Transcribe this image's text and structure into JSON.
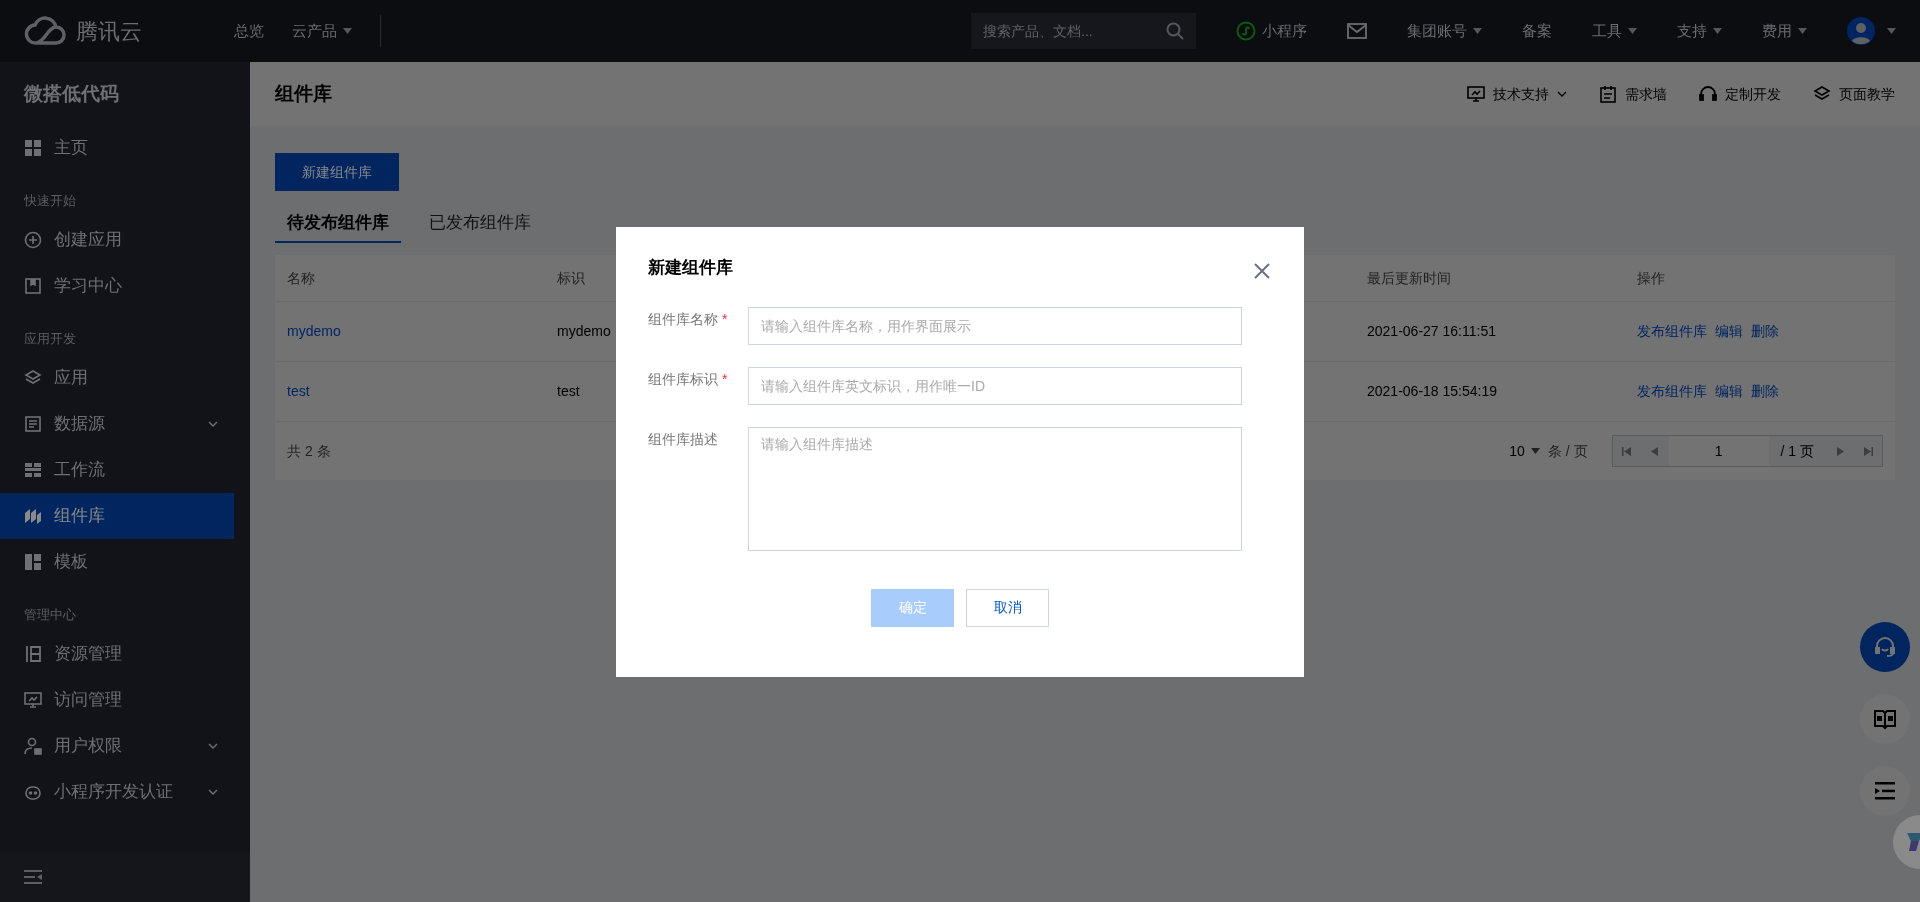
{
  "topbar": {
    "brand": "腾讯云",
    "nav": [
      {
        "label": "总览",
        "dropdown": false
      },
      {
        "label": "云产品",
        "dropdown": true
      }
    ],
    "search": {
      "placeholder": "搜索产品、文档..."
    },
    "links": [
      {
        "kind": "miniprogram",
        "label": "小程序",
        "dropdown": false
      },
      {
        "kind": "mail",
        "dropdown": false
      },
      {
        "kind": "text",
        "label": "集团账号",
        "dropdown": true
      },
      {
        "kind": "text",
        "label": "备案",
        "dropdown": false
      },
      {
        "kind": "text",
        "label": "工具",
        "dropdown": true
      },
      {
        "kind": "text",
        "label": "支持",
        "dropdown": true
      },
      {
        "kind": "text",
        "label": "费用",
        "dropdown": true
      },
      {
        "kind": "avatar",
        "dropdown": true
      }
    ]
  },
  "sidebar": {
    "title": "微搭低代码",
    "groups": [
      {
        "items": [
          {
            "label": "主页",
            "expandable": false,
            "selected": false
          }
        ]
      },
      {
        "heading": "快速开始",
        "items": [
          {
            "label": "创建应用",
            "expandable": false,
            "selected": false
          },
          {
            "label": "学习中心",
            "expandable": false,
            "selected": false
          }
        ]
      },
      {
        "heading": "应用开发",
        "items": [
          {
            "label": "应用",
            "expandable": false,
            "selected": false
          },
          {
            "label": "数据源",
            "expandable": true,
            "selected": false
          },
          {
            "label": "工作流",
            "expandable": false,
            "selected": false
          },
          {
            "label": "组件库",
            "expandable": false,
            "selected": true
          },
          {
            "label": "模板",
            "expandable": false,
            "selected": false
          }
        ]
      },
      {
        "heading": "管理中心",
        "items": [
          {
            "label": "资源管理",
            "expandable": false,
            "selected": false
          },
          {
            "label": "访问管理",
            "expandable": false,
            "selected": false
          },
          {
            "label": "用户权限",
            "expandable": true,
            "selected": false
          },
          {
            "label": "小程序开发认证",
            "expandable": true,
            "selected": false
          }
        ]
      }
    ]
  },
  "header": {
    "title": "组件库",
    "actions": [
      {
        "label": "技术支持",
        "dropdown": true
      },
      {
        "label": "需求墙",
        "dropdown": false
      },
      {
        "label": "定制开发",
        "dropdown": false
      },
      {
        "label": "页面教学",
        "dropdown": false
      }
    ]
  },
  "new_button": "新建组件库",
  "tabs": [
    {
      "label": "待发布组件库",
      "selected": true
    },
    {
      "label": "已发布组件库",
      "selected": false
    }
  ],
  "table": {
    "columns": [
      "名称",
      "标识",
      "最后更新时间",
      "操作"
    ],
    "rows": [
      {
        "name": "mydemo",
        "id": "mydemo",
        "updated": "2021-06-27 16:11:51",
        "actions": [
          "发布组件库",
          "编辑",
          "删除"
        ]
      },
      {
        "name": "test",
        "id": "test",
        "updated": "2021-06-18 15:54:19",
        "actions": [
          "发布组件库",
          "编辑",
          "删除"
        ]
      }
    ],
    "total": "共 2 条",
    "page_size": "10",
    "page_size_unit": "条 / 页",
    "page": "1",
    "pages": "/ 1 页"
  },
  "dialog": {
    "title": "新建组件库",
    "fields": [
      {
        "kind": "input",
        "label": "组件库名称",
        "required_mark": "*",
        "placeholder": "请输入组件库名称，用作界面展示"
      },
      {
        "kind": "input",
        "label": "组件库标识",
        "required_mark": "*",
        "placeholder": "请输入组件库英文标识，用作唯一ID"
      },
      {
        "kind": "textarea",
        "label": "组件库描述",
        "placeholder": "请输入组件库描述"
      }
    ],
    "buttons": [
      {
        "label": "确定",
        "kind": "primary",
        "disabled": true
      },
      {
        "label": "取消",
        "kind": "secondary",
        "disabled": false
      }
    ]
  },
  "float_buttons": [
    {
      "kind": "headset",
      "selected": true
    },
    {
      "kind": "book",
      "selected": false
    },
    {
      "kind": "outline",
      "selected": false
    },
    {
      "kind": "assistant",
      "selected": false
    }
  ]
}
